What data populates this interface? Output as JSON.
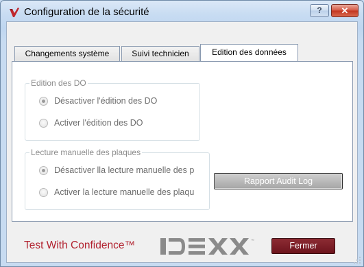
{
  "window": {
    "title": "Configuration de la sécurité",
    "help_label": "?",
    "close_label": "✕"
  },
  "tabs": [
    {
      "label": "Changements système",
      "active": false
    },
    {
      "label": "Suivi technicien",
      "active": false
    },
    {
      "label": "Edition des données",
      "active": true
    }
  ],
  "groups": {
    "edition_do": {
      "legend": "Edition des DO",
      "options": [
        {
          "label": "Désactiver l'édition des DO",
          "checked": true,
          "enabled": false
        },
        {
          "label": "Activer l'édition des DO",
          "checked": false,
          "enabled": false
        }
      ]
    },
    "lecture_plaques": {
      "legend": "Lecture manuelle des plaques",
      "options": [
        {
          "label": "Désactiver lla lecture manuelle des p",
          "checked": true,
          "enabled": false
        },
        {
          "label": "Activer la lecture manuelle des plaqu",
          "checked": false,
          "enabled": false
        }
      ]
    }
  },
  "buttons": {
    "audit_label": "Rapport Audit Log",
    "close_label": "Fermer"
  },
  "footer": {
    "slogan": "Test With Confidence™",
    "logo_text": "IDEXX"
  },
  "colors": {
    "brand_red": "#b22330",
    "brand_button": "#7a1c25",
    "logo_gray": "#8a8a8a"
  }
}
